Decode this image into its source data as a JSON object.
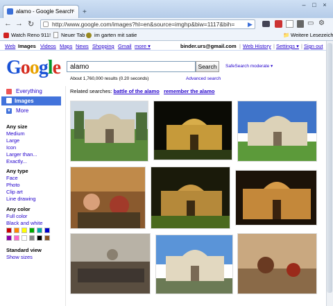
{
  "browser": {
    "tab_title": "alamo - Google Search",
    "tab_close": "×",
    "new_tab": "+",
    "win_min": "–",
    "win_max": "□",
    "win_close": "×",
    "url": "http://www.google.com/images?hl=en&source=imghp&biw=1117&bih=",
    "bookmarks": [
      "Watch Reno 911!",
      "Neuer Tab",
      "im garten mit satie"
    ],
    "other_bookmarks": "Weitere Lesezeichen"
  },
  "google_bar": {
    "links": [
      "Web",
      "Images",
      "Videos",
      "Maps",
      "News",
      "Shopping",
      "Gmail",
      "more ▾"
    ],
    "email": "binder.urs@gmail.com",
    "web_history": "Web History",
    "settings": "Settings ▾",
    "sign_out": "Sign out",
    "sep": "|"
  },
  "logo": {
    "letters": [
      "G",
      "o",
      "o",
      "g",
      "l",
      "e"
    ],
    "colors": [
      "#1a53d6",
      "#d62d20",
      "#e8a200",
      "#1a53d6",
      "#00962a",
      "#d62d20"
    ]
  },
  "search": {
    "query": "alamo",
    "button": "Search",
    "safesearch": "SafeSearch moderate ▾",
    "advanced": "Advanced search",
    "results": "About 1,760,000 results (0.20 seconds)"
  },
  "related": {
    "label": "Related searches:",
    "items": [
      "battle of the alamo",
      "remember the alamo"
    ]
  },
  "sidebar": {
    "everything": "Everything",
    "images": "Images",
    "more": "More",
    "size_head": "Any size",
    "sizes": [
      "Medium",
      "Large",
      "Icon",
      "Larger than...",
      "Exactly..."
    ],
    "type_head": "Any type",
    "types": [
      "Face",
      "Photo",
      "Clip art",
      "Line drawing"
    ],
    "color_head": "Any color",
    "colors_links": [
      "Full color",
      "Black and white"
    ],
    "swatches": [
      "#cc0000",
      "#ff8800",
      "#ffff00",
      "#00aa00",
      "#00aaaa",
      "#0000cc",
      "#8800aa",
      "#ff66cc",
      "#ffffff",
      "#888888",
      "#000000",
      "#885522"
    ],
    "view_head": "Standard view",
    "view_link": "Show sizes"
  }
}
